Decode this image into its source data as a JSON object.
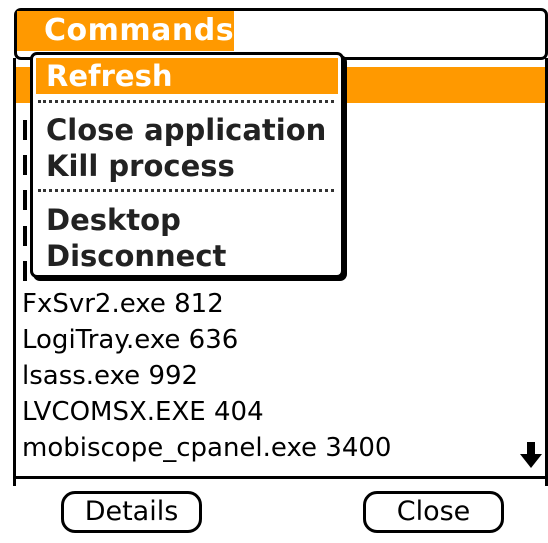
{
  "menu": {
    "title": "Commands",
    "items": [
      {
        "label": "Refresh",
        "selected": true
      },
      {
        "label": "Close application",
        "selected": false
      },
      {
        "label": "Kill process",
        "selected": false
      },
      {
        "label": "Desktop",
        "selected": false
      },
      {
        "label": "Disconnect",
        "selected": false
      }
    ]
  },
  "process_list": {
    "items": [
      {
        "text": "FxSvr2.exe 812"
      },
      {
        "text": "LogiTray.exe 636"
      },
      {
        "text": "lsass.exe 992"
      },
      {
        "text": "LVCOMSX.EXE 404"
      },
      {
        "text": "mobiscope_cpanel.exe 3400"
      }
    ]
  },
  "buttons": {
    "details": "Details",
    "close": "Close"
  },
  "icons": {
    "scroll_down": "arrow-down-icon"
  },
  "colors": {
    "accent": "#ff9900",
    "text": "#000000",
    "background": "#ffffff"
  }
}
